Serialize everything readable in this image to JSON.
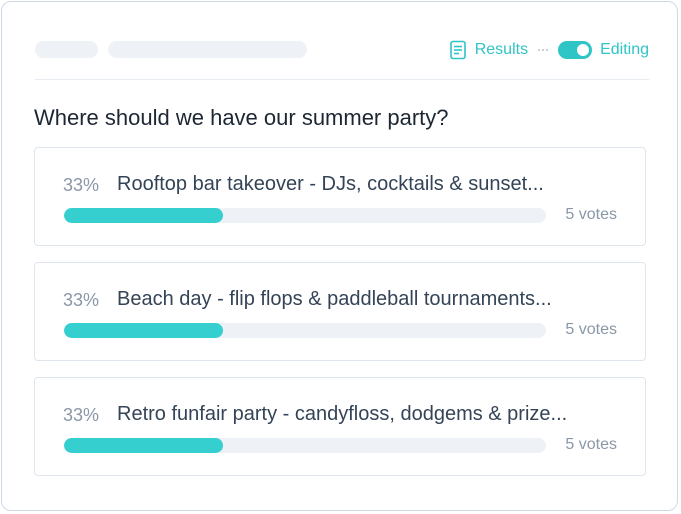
{
  "header": {
    "results_label": "Results",
    "editing_label": "Editing",
    "editing_on": true
  },
  "poll": {
    "question": "Where should we have our summer party?",
    "options": [
      {
        "percent": "33%",
        "label": "Rooftop bar takeover - DJs, cocktails & sunset...",
        "fraction": 0.33,
        "votes": "5 votes"
      },
      {
        "percent": "33%",
        "label": "Beach day - flip flops & paddleball tournaments...",
        "fraction": 0.33,
        "votes": "5 votes"
      },
      {
        "percent": "33%",
        "label": "Retro funfair party - candyfloss, dodgems & prize...",
        "fraction": 0.33,
        "votes": "5 votes"
      }
    ]
  },
  "colors": {
    "accent": "#2fc4c6",
    "bar_fill": "#35cfcf",
    "track": "#eef1f6"
  }
}
